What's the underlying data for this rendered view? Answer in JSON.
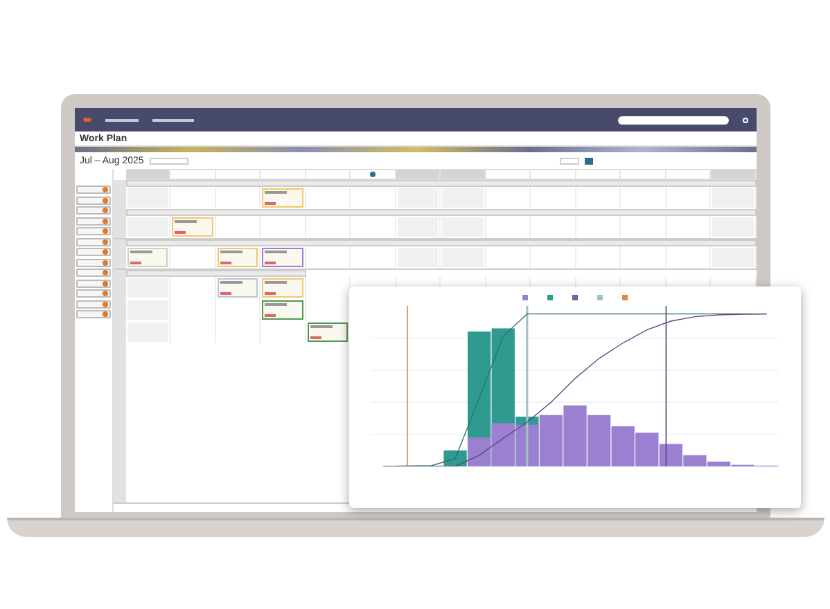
{
  "page": {
    "title": "Work Plan",
    "range": "Jul – Aug 2025"
  },
  "days": [
    {
      "weekend": true,
      "today": false
    },
    {
      "weekend": false,
      "today": false
    },
    {
      "weekend": false,
      "today": false
    },
    {
      "weekend": false,
      "today": false
    },
    {
      "weekend": false,
      "today": false
    },
    {
      "weekend": false,
      "today": true
    },
    {
      "weekend": true,
      "today": false
    },
    {
      "weekend": true,
      "today": false
    },
    {
      "weekend": false,
      "today": false
    },
    {
      "weekend": false,
      "today": false
    },
    {
      "weekend": false,
      "today": false
    },
    {
      "weekend": false,
      "today": false
    },
    {
      "weekend": false,
      "today": false
    },
    {
      "weekend": true,
      "today": false
    }
  ],
  "crews": [
    {
      "color": "#e07a2a"
    },
    {
      "color": "#e07a2a"
    },
    {
      "color": "#e07a2a"
    },
    {
      "color": "#e07a2a"
    },
    {
      "color": "#e07a2a"
    },
    {
      "color": "#e07a2a"
    },
    {
      "color": "#e07a2a"
    },
    {
      "color": "#e07a2a"
    },
    {
      "color": "#e07a2a"
    },
    {
      "color": "#e07a2a"
    },
    {
      "color": "#e07a2a"
    },
    {
      "color": "#e07a2a"
    },
    {
      "color": "#e07a2a"
    }
  ],
  "lanes": [
    {
      "paths": [
        {
          "rows": [
            [
              {
                "kind": "empty"
              },
              {
                "kind": "empty"
              },
              {
                "kind": "empty"
              },
              {
                "kind": "task",
                "color": "#f2c86b"
              }
            ]
          ]
        },
        {
          "rows": [
            [
              {
                "kind": "empty"
              },
              {
                "kind": "task",
                "color": "#f2c86b"
              }
            ]
          ]
        }
      ]
    },
    {
      "paths": [
        {
          "rows": [
            [
              {
                "kind": "task",
                "color": "#c9d3c0"
              },
              {
                "kind": "empty"
              },
              {
                "kind": "task",
                "color": "#f2c86b"
              },
              {
                "kind": "task",
                "color": "#9b7fd0"
              }
            ]
          ]
        }
      ]
    },
    {
      "paths": [
        {
          "rows": [
            [
              {
                "kind": "empty"
              },
              {
                "kind": "empty"
              },
              {
                "kind": "task",
                "color": "#b8c8d8"
              },
              {
                "kind": "task",
                "color": "#f2c86b"
              }
            ],
            [
              {
                "kind": "empty"
              },
              {
                "kind": "empty"
              },
              {
                "kind": "empty"
              },
              {
                "kind": "task",
                "color": "#4f9a4f"
              }
            ],
            [
              {
                "kind": "empty"
              },
              {
                "kind": "empty"
              },
              {
                "kind": "empty"
              },
              {
                "kind": "empty"
              },
              {
                "kind": "task",
                "color": "#4f9a4f"
              }
            ]
          ]
        }
      ]
    }
  ],
  "chart": {
    "legend": [
      {
        "color": "#9b7fd0"
      },
      {
        "color": "#2e9a90"
      },
      {
        "color": "#7a5aa8"
      },
      {
        "color": "#9fc5c2"
      },
      {
        "color": "#e08a3a"
      }
    ]
  }
}
